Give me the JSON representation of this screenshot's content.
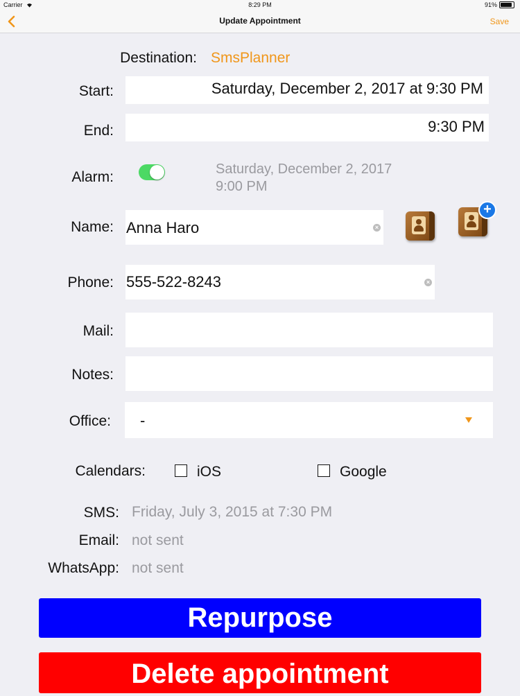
{
  "status_bar": {
    "carrier": "Carrier",
    "time": "8:29 PM",
    "battery": "91%"
  },
  "nav": {
    "title": "Update Appointment",
    "save_label": "Save"
  },
  "form": {
    "destination_label": "Destination:",
    "destination_value": "SmsPlanner",
    "start_label": "Start:",
    "start_value": "Saturday, December 2, 2017 at 9:30 PM",
    "end_label": "End:",
    "end_value": "9:30 PM",
    "alarm_label": "Alarm:",
    "alarm_date": "Saturday, December 2, 2017",
    "alarm_time": "9:00 PM",
    "alarm_on": true,
    "name_label": "Name:",
    "name_value": "Anna Haro",
    "phone_label": "Phone:",
    "phone_value": "555-522-8243",
    "mail_label": "Mail:",
    "mail_value": "",
    "notes_label": "Notes:",
    "notes_value": "",
    "office_label": "Office:",
    "office_value": "-",
    "calendars_label": "Calendars:",
    "calendar_ios": "iOS",
    "calendar_google": "Google",
    "sms_label": "SMS:",
    "sms_value": "Friday, July 3, 2015 at 7:30 PM",
    "email_label": "Email:",
    "email_value": "not sent",
    "whatsapp_label": "WhatsApp:",
    "whatsapp_value": "not sent"
  },
  "buttons": {
    "repurpose": "Repurpose",
    "delete": "Delete appointment"
  },
  "colors": {
    "accent": "#f0961a",
    "repurpose": "#0000ff",
    "delete": "#ff0000",
    "toggle_on": "#4cd964"
  },
  "icons": [
    "back-chevron-icon",
    "wifi-icon",
    "battery-icon",
    "contacts-book-icon",
    "add-contact-icon",
    "clear-icon",
    "dropdown-arrow-icon",
    "checkbox-icon"
  ]
}
